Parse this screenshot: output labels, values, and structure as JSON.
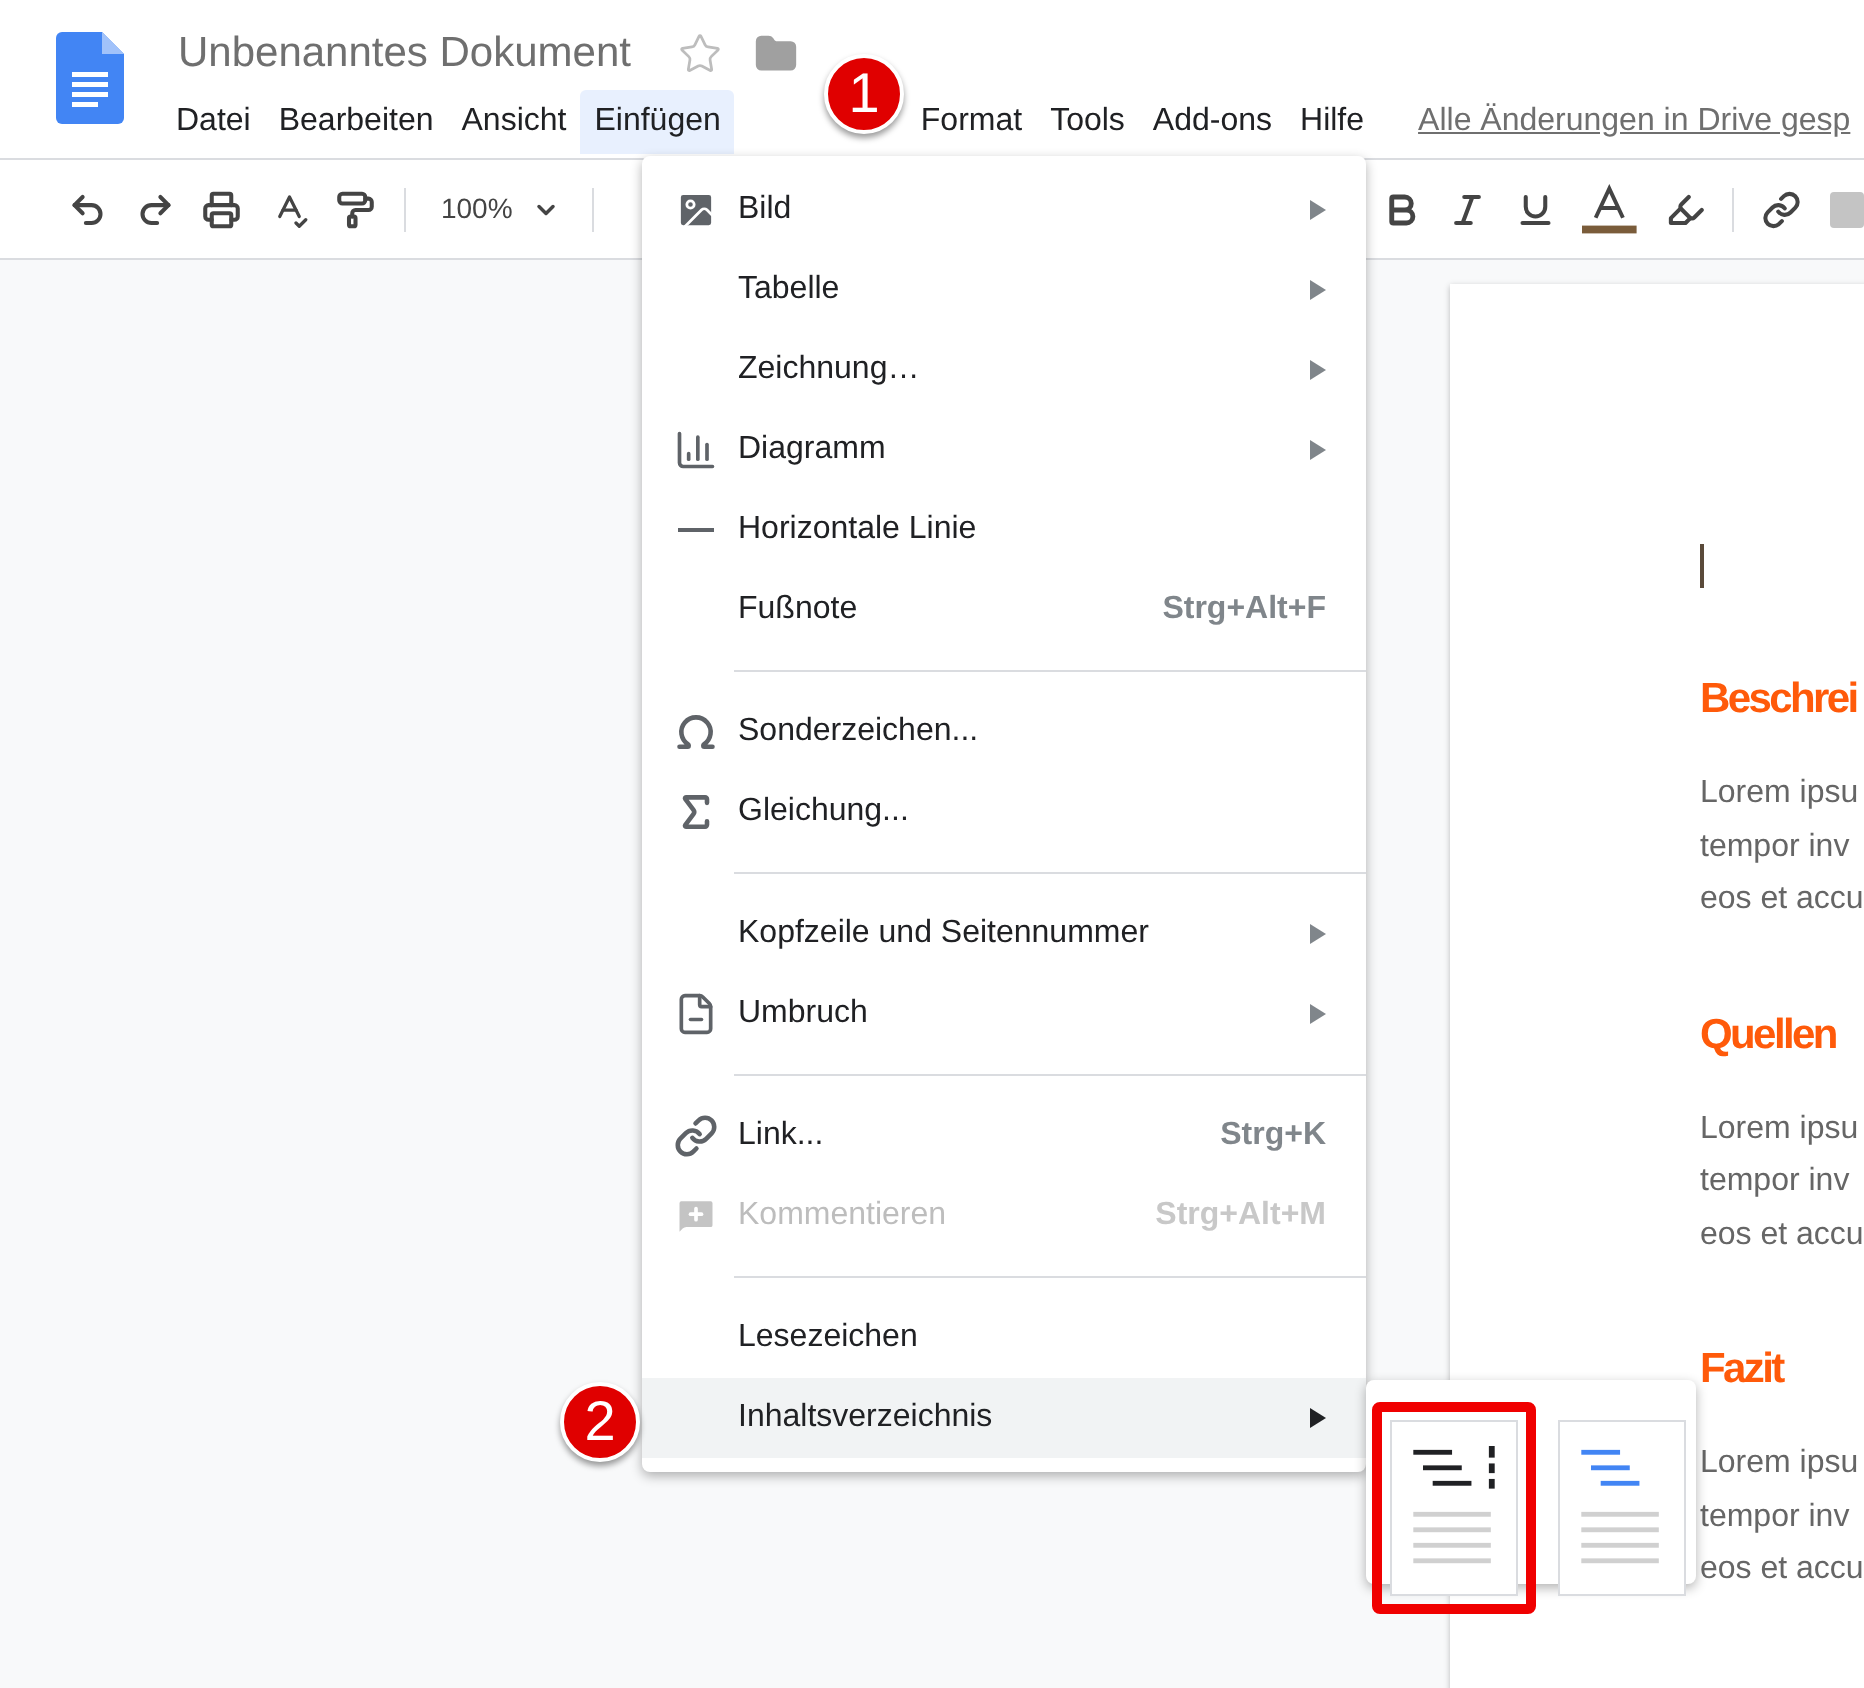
{
  "header": {
    "title": "Unbenanntes Dokument",
    "starred": false,
    "save_status": "Alle Änderungen in Drive gesp"
  },
  "menubar": [
    {
      "label": "Datei",
      "selected": false
    },
    {
      "label": "Bearbeiten",
      "selected": false
    },
    {
      "label": "Ansicht",
      "selected": false
    },
    {
      "label": "Einfügen",
      "selected": true
    },
    {
      "label": "Format",
      "selected": false
    },
    {
      "label": "Tools",
      "selected": false
    },
    {
      "label": "Add-ons",
      "selected": false
    },
    {
      "label": "Hilfe",
      "selected": false
    }
  ],
  "toolbar": {
    "zoom": "100%"
  },
  "insert_menu": {
    "groups": [
      [
        {
          "label": "Bild",
          "submenu": true,
          "disabled": false,
          "selected": false
        },
        {
          "label": "Tabelle",
          "submenu": true,
          "disabled": false,
          "selected": false
        },
        {
          "label": "Zeichnung…",
          "submenu": true,
          "disabled": false,
          "selected": false
        },
        {
          "label": "Diagramm",
          "submenu": true,
          "disabled": false,
          "selected": false
        },
        {
          "label": "Horizontale Linie",
          "submenu": false,
          "disabled": false,
          "selected": false
        },
        {
          "label": "Fußnote",
          "shortcut": "Strg+Alt+F",
          "submenu": false,
          "disabled": false,
          "selected": false
        }
      ],
      [
        {
          "label": "Sonderzeichen...",
          "submenu": false,
          "disabled": false,
          "selected": false
        },
        {
          "label": "Gleichung...",
          "submenu": false,
          "disabled": false,
          "selected": false
        }
      ],
      [
        {
          "label": "Kopfzeile und Seitennummer",
          "submenu": true,
          "disabled": false,
          "selected": false
        },
        {
          "label": "Umbruch",
          "submenu": true,
          "disabled": false,
          "selected": false
        }
      ],
      [
        {
          "label": "Link...",
          "shortcut": "Strg+K",
          "submenu": false,
          "disabled": false,
          "selected": false
        },
        {
          "label": "Kommentieren",
          "shortcut": "Strg+Alt+M",
          "submenu": false,
          "disabled": true,
          "selected": false
        }
      ],
      [
        {
          "label": "Lesezeichen",
          "submenu": false,
          "disabled": false,
          "selected": false
        },
        {
          "label": "Inhaltsverzeichnis",
          "submenu": true,
          "disabled": false,
          "selected": true
        }
      ]
    ]
  },
  "toc_submenu": [
    {
      "kind": "numbered",
      "selected": true
    },
    {
      "kind": "linked",
      "selected": false
    }
  ],
  "callouts": [
    "1",
    "2"
  ],
  "document": [
    {
      "kind": "heading",
      "text": "Beschrei"
    },
    {
      "kind": "paragraph",
      "lines": [
        "Lorem ipsu",
        "tempor inv",
        "eos et accu"
      ]
    },
    {
      "kind": "heading",
      "text": "Quellen"
    },
    {
      "kind": "paragraph",
      "lines": [
        "Lorem ipsu",
        "tempor inv",
        "eos et accu"
      ]
    },
    {
      "kind": "heading",
      "text": "Fazit"
    },
    {
      "kind": "paragraph",
      "lines": [
        "Lorem ipsu",
        "tempor inv",
        "eos et accu"
      ]
    }
  ]
}
